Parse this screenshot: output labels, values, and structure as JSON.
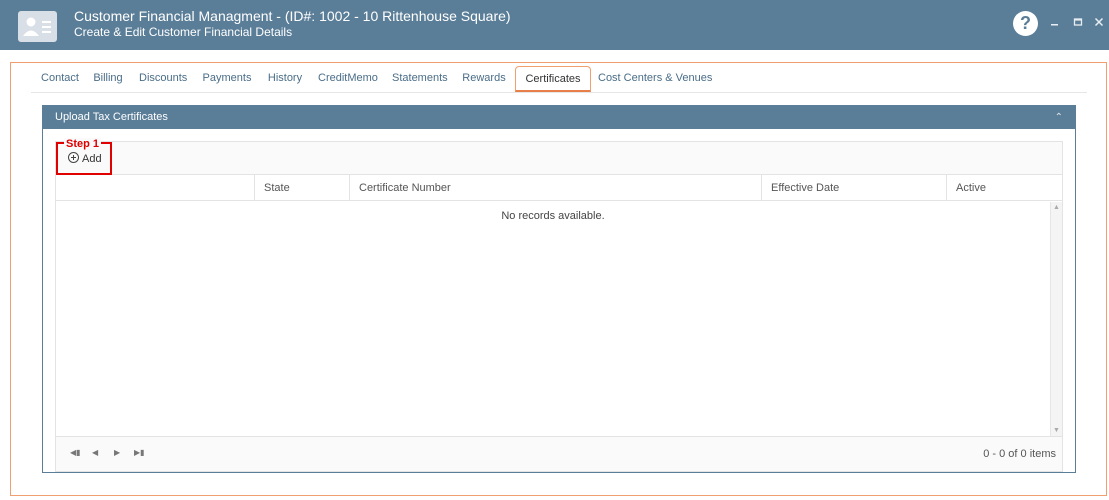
{
  "window": {
    "title": "Customer Financial Managment - (ID#: 1002 - 10 Rittenhouse Square)",
    "subtitle": "Create & Edit Customer Financial Details",
    "help_label": "?",
    "accent_color": "#5a7d98"
  },
  "tabs": [
    {
      "label": "Contact"
    },
    {
      "label": "Billing"
    },
    {
      "label": "Discounts"
    },
    {
      "label": "Payments"
    },
    {
      "label": "History"
    },
    {
      "label": "CreditMemo"
    },
    {
      "label": "Statements"
    },
    {
      "label": "Rewards"
    },
    {
      "label": "Certificates",
      "active": true
    },
    {
      "label": "Cost Centers & Venues"
    }
  ],
  "panel": {
    "title": "Upload Tax Certificates",
    "step_label": "Step 1",
    "add_label": "Add",
    "columns": [
      "",
      "State",
      "Certificate Number",
      "Effective Date",
      "Active"
    ],
    "empty_message": "No records available.",
    "pager_info": "0 - 0 of 0 items"
  }
}
